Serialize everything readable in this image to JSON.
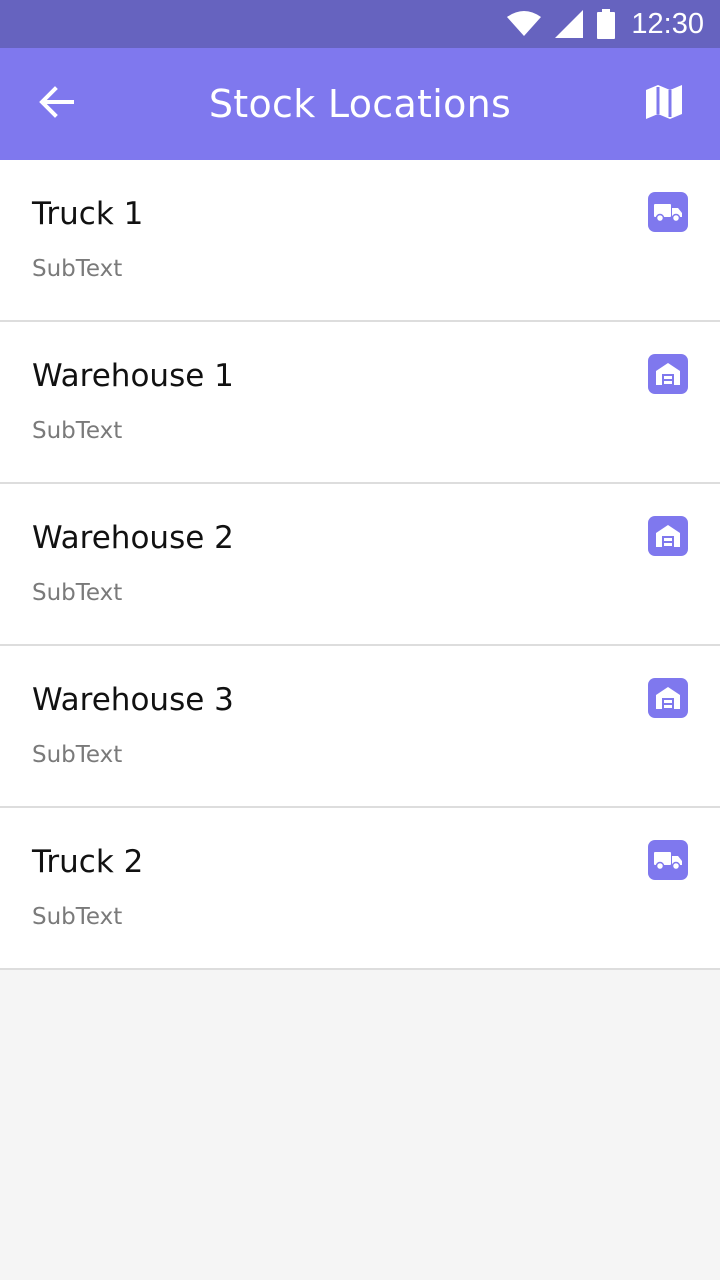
{
  "status_bar": {
    "time": "12:30",
    "icons": [
      "wifi-icon",
      "cell-signal-icon",
      "battery-icon"
    ]
  },
  "app_bar": {
    "title": "Stock Locations",
    "back_icon": "arrow-left-icon",
    "action_icon": "map-icon"
  },
  "colors": {
    "status_bar": "#6663bf",
    "app_bar": "#7f78ee",
    "icon_badge": "#7f78ee",
    "background": "#f5f5f5"
  },
  "locations": [
    {
      "title": "Truck 1",
      "subtitle": "SubText",
      "icon": "truck-icon"
    },
    {
      "title": "Warehouse 1",
      "subtitle": "SubText",
      "icon": "warehouse-icon"
    },
    {
      "title": "Warehouse 2",
      "subtitle": "SubText",
      "icon": "warehouse-icon"
    },
    {
      "title": "Warehouse 3",
      "subtitle": "SubText",
      "icon": "warehouse-icon"
    },
    {
      "title": "Truck 2",
      "subtitle": "SubText",
      "icon": "truck-icon"
    }
  ]
}
